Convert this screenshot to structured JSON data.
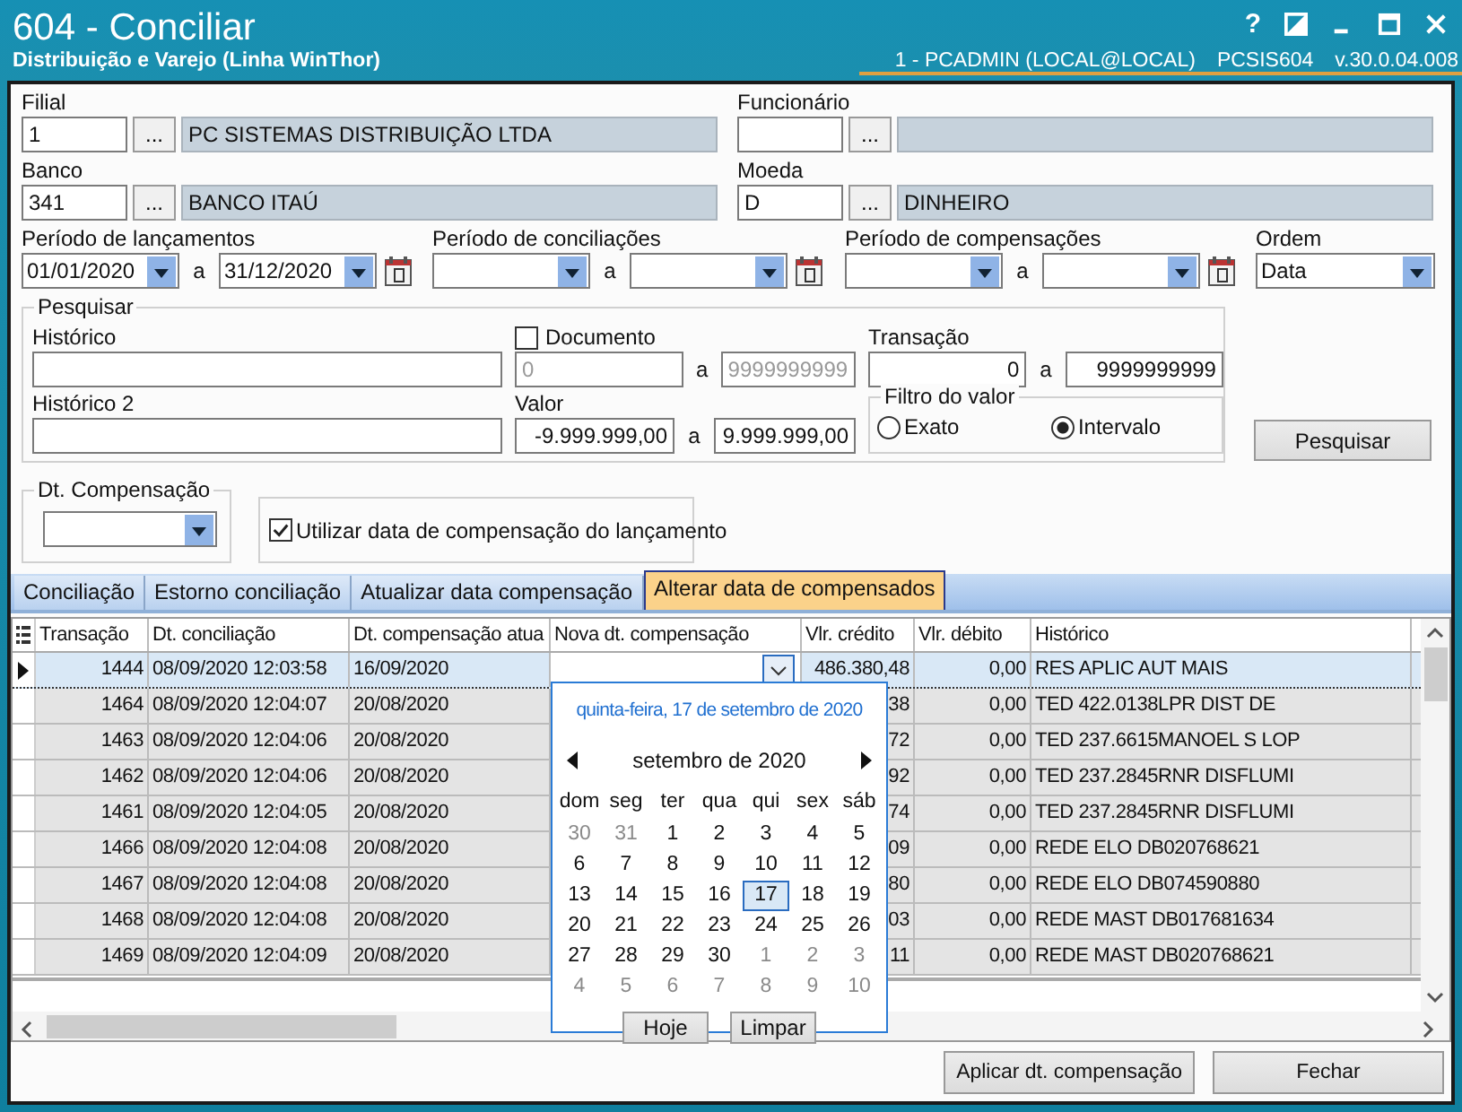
{
  "window": {
    "title": "604 - Conciliar",
    "subtitle": "Distribuição e Varejo (Linha WinThor)",
    "help": "?",
    "user": "1 - PCADMIN (LOCAL@LOCAL)",
    "program": "PCSIS604",
    "version": "v.30.0.04.008"
  },
  "lookups": [
    {
      "label": "Filial",
      "code": "1",
      "button": "...",
      "name": "PC SISTEMAS DISTRIBUIÇÃO LTDA"
    },
    {
      "label": "Funcionário",
      "button": "..."
    },
    {
      "label": "Banco",
      "code": "341",
      "button": "...",
      "name": "BANCO ITAÚ"
    },
    {
      "label": "Moeda",
      "code": "D",
      "button": "...",
      "name": "DINHEIRO"
    }
  ],
  "periods": [
    {
      "label": "Período de lançamentos",
      "from": "01/01/2020",
      "sep": "a",
      "to": "31/12/2020"
    },
    {
      "label": "Período de conciliações",
      "sep": "a"
    },
    {
      "label": "Período de compensações",
      "sep": "a"
    }
  ],
  "ordem": {
    "label": "Ordem",
    "value": "Data"
  },
  "pesquisar": {
    "title": "Pesquisar",
    "historico": "Histórico",
    "historico2": "Histórico 2",
    "documento": {
      "label": "Documento",
      "checked": false,
      "from": "0",
      "sep": "a",
      "to": "9999999999"
    },
    "transacao": {
      "label": "Transação",
      "from": "0",
      "sep": "a",
      "to": "9999999999"
    },
    "valor": {
      "label": "Valor",
      "from": "-9.999.999,00",
      "sep": "a",
      "to": "9.999.999,00"
    },
    "filtro": {
      "title": "Filtro do valor",
      "options": [
        {
          "label": "Exato",
          "selected": false
        },
        {
          "label": "Intervalo",
          "selected": true
        }
      ]
    },
    "button": "Pesquisar"
  },
  "dt_compensacao": {
    "title": "Dt. Compensação"
  },
  "usar_data": {
    "label": "Utilizar data de compensação do lançamento",
    "checked": true
  },
  "tabs": [
    {
      "label": "Conciliação",
      "selected": false
    },
    {
      "label": "Estorno conciliação",
      "selected": false
    },
    {
      "label": "Atualizar data compensação",
      "selected": false
    },
    {
      "label": "Alterar data de compensados",
      "selected": true
    }
  ],
  "table": {
    "columns": [
      "Transação",
      "Dt. conciliação",
      "Dt. compensação atua",
      "Nova dt. compensação",
      "Vlr. crédito",
      "Vlr. débito",
      "Histórico"
    ],
    "rows": [
      {
        "selected": true,
        "transacao": "1444",
        "dt_conciliacao": "08/09/2020 12:03:58",
        "dt_compensacao": "16/09/2020",
        "credito": "486.380,48",
        "debito": "0,00",
        "historico": "RES APLIC AUT MAIS"
      },
      {
        "selected": false,
        "transacao": "1464",
        "dt_conciliacao": "08/09/2020 12:04:07",
        "dt_compensacao": "20/08/2020",
        "credito": "38",
        "debito": "0,00",
        "historico": "TED 422.0138LPR DIST DE"
      },
      {
        "selected": false,
        "transacao": "1463",
        "dt_conciliacao": "08/09/2020 12:04:06",
        "dt_compensacao": "20/08/2020",
        "credito": "72",
        "debito": "0,00",
        "historico": "TED 237.6615MANOEL S LOP"
      },
      {
        "selected": false,
        "transacao": "1462",
        "dt_conciliacao": "08/09/2020 12:04:06",
        "dt_compensacao": "20/08/2020",
        "credito": "92",
        "debito": "0,00",
        "historico": "TED 237.2845RNR DISFLUMI"
      },
      {
        "selected": false,
        "transacao": "1461",
        "dt_conciliacao": "08/09/2020 12:04:05",
        "dt_compensacao": "20/08/2020",
        "credito": "74",
        "debito": "0,00",
        "historico": "TED 237.2845RNR DISFLUMI"
      },
      {
        "selected": false,
        "transacao": "1466",
        "dt_conciliacao": "08/09/2020 12:04:08",
        "dt_compensacao": "20/08/2020",
        "credito": "09",
        "debito": "0,00",
        "historico": "REDE   ELO  DB020768621"
      },
      {
        "selected": false,
        "transacao": "1467",
        "dt_conciliacao": "08/09/2020 12:04:08",
        "dt_compensacao": "20/08/2020",
        "credito": "80",
        "debito": "0,00",
        "historico": "REDE   ELO  DB074590880"
      },
      {
        "selected": false,
        "transacao": "1468",
        "dt_conciliacao": "08/09/2020 12:04:08",
        "dt_compensacao": "20/08/2020",
        "credito": "03",
        "debito": "0,00",
        "historico": "REDE   MAST DB017681634"
      },
      {
        "selected": false,
        "transacao": "1469",
        "dt_conciliacao": "08/09/2020 12:04:09",
        "dt_compensacao": "20/08/2020",
        "credito": "11",
        "debito": "0,00",
        "historico": "REDE   MAST DB020768621"
      }
    ]
  },
  "calendar": {
    "heading": "quinta-feira, 17 de setembro de 2020",
    "month": "setembro de 2020",
    "weekdays": [
      "dom",
      "seg",
      "ter",
      "qua",
      "qui",
      "sex",
      "sáb"
    ],
    "weeks": [
      [
        {
          "day": "30",
          "other_month": true,
          "selected": false
        },
        {
          "day": "31",
          "other_month": true,
          "selected": false
        },
        {
          "day": "1",
          "other_month": false,
          "selected": false
        },
        {
          "day": "2",
          "other_month": false,
          "selected": false
        },
        {
          "day": "3",
          "other_month": false,
          "selected": false
        },
        {
          "day": "4",
          "other_month": false,
          "selected": false
        },
        {
          "day": "5",
          "other_month": false,
          "selected": false
        }
      ],
      [
        {
          "day": "6",
          "other_month": false,
          "selected": false
        },
        {
          "day": "7",
          "other_month": false,
          "selected": false
        },
        {
          "day": "8",
          "other_month": false,
          "selected": false
        },
        {
          "day": "9",
          "other_month": false,
          "selected": false
        },
        {
          "day": "10",
          "other_month": false,
          "selected": false
        },
        {
          "day": "11",
          "other_month": false,
          "selected": false
        },
        {
          "day": "12",
          "other_month": false,
          "selected": false
        }
      ],
      [
        {
          "day": "13",
          "other_month": false,
          "selected": false
        },
        {
          "day": "14",
          "other_month": false,
          "selected": false
        },
        {
          "day": "15",
          "other_month": false,
          "selected": false
        },
        {
          "day": "16",
          "other_month": false,
          "selected": false
        },
        {
          "day": "17",
          "other_month": false,
          "selected": true
        },
        {
          "day": "18",
          "other_month": false,
          "selected": false
        },
        {
          "day": "19",
          "other_month": false,
          "selected": false
        }
      ],
      [
        {
          "day": "20",
          "other_month": false,
          "selected": false
        },
        {
          "day": "21",
          "other_month": false,
          "selected": false
        },
        {
          "day": "22",
          "other_month": false,
          "selected": false
        },
        {
          "day": "23",
          "other_month": false,
          "selected": false
        },
        {
          "day": "24",
          "other_month": false,
          "selected": false
        },
        {
          "day": "25",
          "other_month": false,
          "selected": false
        },
        {
          "day": "26",
          "other_month": false,
          "selected": false
        }
      ],
      [
        {
          "day": "27",
          "other_month": false,
          "selected": false
        },
        {
          "day": "28",
          "other_month": false,
          "selected": false
        },
        {
          "day": "29",
          "other_month": false,
          "selected": false
        },
        {
          "day": "30",
          "other_month": false,
          "selected": false
        },
        {
          "day": "1",
          "other_month": true,
          "selected": false
        },
        {
          "day": "2",
          "other_month": true,
          "selected": false
        },
        {
          "day": "3",
          "other_month": true,
          "selected": false
        }
      ],
      [
        {
          "day": "4",
          "other_month": true,
          "selected": false
        },
        {
          "day": "5",
          "other_month": true,
          "selected": false
        },
        {
          "day": "6",
          "other_month": true,
          "selected": false
        },
        {
          "day": "7",
          "other_month": true,
          "selected": false
        },
        {
          "day": "8",
          "other_month": true,
          "selected": false
        },
        {
          "day": "9",
          "other_month": true,
          "selected": false
        },
        {
          "day": "10",
          "other_month": true,
          "selected": false
        }
      ]
    ],
    "buttons": [
      "Hoje",
      "Limpar"
    ]
  },
  "footer_buttons": [
    "Aplicar dt. compensação",
    "Fechar"
  ]
}
